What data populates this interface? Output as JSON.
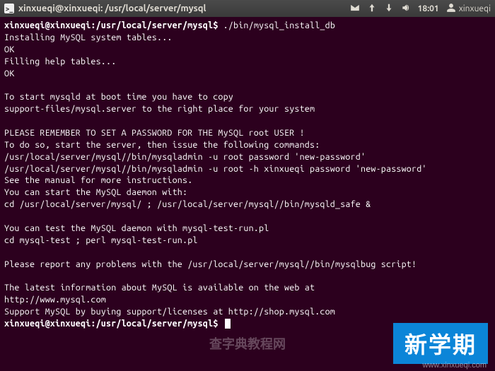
{
  "menubar": {
    "window_title": "xinxueqi@xinxueqi: /usr/local/server/mysql",
    "clock": "18:01",
    "username": "xinxueqi",
    "icons": {
      "terminal": "terminal-icon",
      "mail": "mail-icon",
      "network_up": "network-up-icon",
      "network_down": "network-down-icon",
      "volume": "volume-icon",
      "user": "user-icon"
    }
  },
  "terminal": {
    "prompt1_user": "xinxueqi@xinxueqi",
    "prompt1_path": "/usr/local/server/mysql",
    "prompt1_sep": ":",
    "prompt1_dollar": "$",
    "command1": "./bin/mysql_install_db",
    "lines": [
      "Installing MySQL system tables...",
      "OK",
      "Filling help tables...",
      "OK",
      "",
      "To start mysqld at boot time you have to copy",
      "support-files/mysql.server to the right place for your system",
      "",
      "PLEASE REMEMBER TO SET A PASSWORD FOR THE MySQL root USER !",
      "To do so, start the server, then issue the following commands:",
      "/usr/local/server/mysql//bin/mysqladmin -u root password 'new-password'",
      "/usr/local/server/mysql//bin/mysqladmin -u root -h xinxueqi password 'new-password'",
      "See the manual for more instructions.",
      "You can start the MySQL daemon with:",
      "cd /usr/local/server/mysql/ ; /usr/local/server/mysql//bin/mysqld_safe &",
      "",
      "You can test the MySQL daemon with mysql-test-run.pl",
      "cd mysql-test ; perl mysql-test-run.pl",
      "",
      "Please report any problems with the /usr/local/server/mysql//bin/mysqlbug script!",
      "",
      "The latest information about MySQL is available on the web at",
      "http://www.mysql.com",
      "Support MySQL by buying support/licenses at http://shop.mysql.com"
    ],
    "prompt2_user": "xinxueqi@xinxueqi",
    "prompt2_path": "/usr/local/server/mysql",
    "prompt2_sep": ":",
    "prompt2_dollar": "$"
  },
  "watermarks": {
    "blue_badge": "新学期",
    "bottom_right": "www.xinxueqi.com",
    "center_faint": "查字典教程网"
  }
}
